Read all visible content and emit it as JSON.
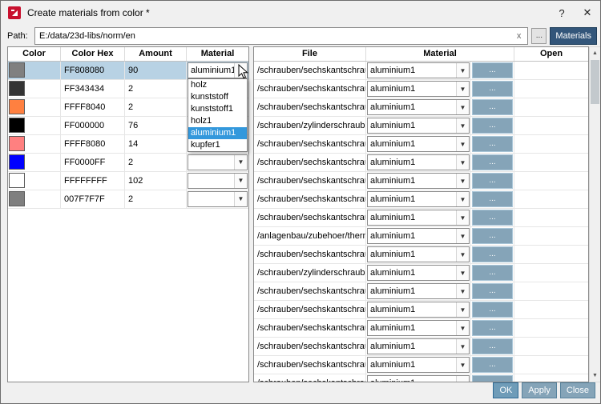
{
  "window": {
    "title": "Create materials from color *",
    "help": "?",
    "close": "✕"
  },
  "path_bar": {
    "label": "Path:",
    "value": "E:/data/23d-libs/norm/en",
    "clear": "x",
    "browse": "...",
    "materials_button": "Materials"
  },
  "icons": {
    "combo_arrow": "▼",
    "scroll_up": "▲",
    "scroll_down": "▼"
  },
  "colors": {
    "selection_blue": "#b8d2e4",
    "dropdown_highlight": "#3398dc",
    "materials_button_blue": "#33567a",
    "steel_button_blue": "#85a4b8",
    "app_icon_red": "#c8102e"
  },
  "color_table": {
    "headers": {
      "color": "Color",
      "hex": "Color Hex",
      "amount": "Amount",
      "material": "Material"
    },
    "rows": [
      {
        "swatch": "#808080",
        "hex": "FF808080",
        "amount": "90",
        "material": "aluminium1",
        "selected": true,
        "combo": true
      },
      {
        "swatch": "#343434",
        "hex": "FF343434",
        "amount": "2",
        "material": "",
        "selected": false,
        "combo": false
      },
      {
        "swatch": "#ff8040",
        "hex": "FFFF8040",
        "amount": "2",
        "material": "",
        "selected": false,
        "combo": false
      },
      {
        "swatch": "#000000",
        "hex": "FF000000",
        "amount": "76",
        "material": "",
        "selected": false,
        "combo": false
      },
      {
        "swatch": "#ff8080",
        "hex": "FFFF8080",
        "amount": "14",
        "material": "",
        "selected": false,
        "combo": false
      },
      {
        "swatch": "#0000ff",
        "hex": "FF0000FF",
        "amount": "2",
        "material": "",
        "selected": false,
        "combo": true
      },
      {
        "swatch": "#ffffff",
        "hex": "FFFFFFFF",
        "amount": "102",
        "material": "",
        "selected": false,
        "combo": true
      },
      {
        "swatch": "#7f7f7f",
        "hex": "007F7F7F",
        "amount": "2",
        "material": "",
        "selected": false,
        "combo": true
      }
    ]
  },
  "material_dropdown": {
    "options": [
      "holz",
      "kunststoff",
      "kunststoff1",
      "holz1",
      "aluminium1",
      "kupfer1"
    ],
    "selected_index": 4
  },
  "file_table": {
    "headers": {
      "file": "File",
      "material": "Material",
      "open": "Open"
    },
    "browse": "...",
    "rows": [
      {
        "file": "/schrauben/sechskantschraub...",
        "material": "aluminium1"
      },
      {
        "file": "/schrauben/sechskantschraub...",
        "material": "aluminium1"
      },
      {
        "file": "/schrauben/sechskantschraub...",
        "material": "aluminium1"
      },
      {
        "file": "/schrauben/zylinderschrauben...",
        "material": "aluminium1"
      },
      {
        "file": "/schrauben/sechskantschraub...",
        "material": "aluminium1"
      },
      {
        "file": "/schrauben/sechskantschraub...",
        "material": "aluminium1"
      },
      {
        "file": "/schrauben/sechskantschraub...",
        "material": "aluminium1"
      },
      {
        "file": "/schrauben/sechskantschraub...",
        "material": "aluminium1"
      },
      {
        "file": "/schrauben/sechskantschraub...",
        "material": "aluminium1"
      },
      {
        "file": "/anlagenbau/zubehoer/therm...",
        "material": "aluminium1"
      },
      {
        "file": "/schrauben/sechskantschraub...",
        "material": "aluminium1"
      },
      {
        "file": "/schrauben/zylinderschrauben...",
        "material": "aluminium1"
      },
      {
        "file": "/schrauben/sechskantschraub...",
        "material": "aluminium1"
      },
      {
        "file": "/schrauben/sechskantschraub...",
        "material": "aluminium1"
      },
      {
        "file": "/schrauben/sechskantschraub...",
        "material": "aluminium1"
      },
      {
        "file": "/schrauben/sechskantschraub...",
        "material": "aluminium1"
      },
      {
        "file": "/schrauben/sechskantschraub...",
        "material": "aluminium1"
      },
      {
        "file": "/schrauben/sechskantschraub...",
        "material": "aluminium1"
      }
    ]
  },
  "footer": {
    "ok": "OK",
    "apply": "Apply",
    "close": "Close"
  }
}
